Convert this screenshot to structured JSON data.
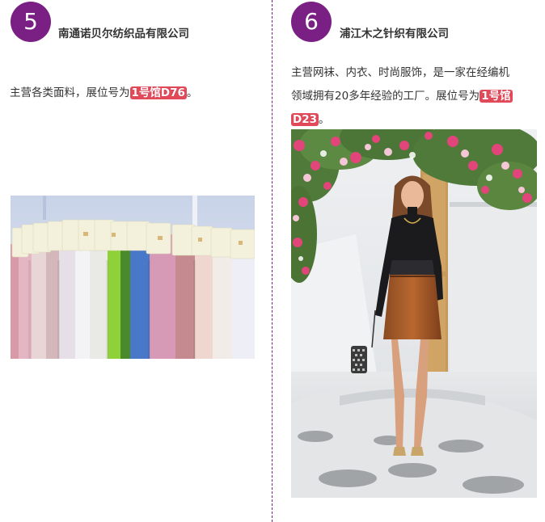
{
  "colors": {
    "accent_purple": "#7a1f83",
    "booth_highlight": "#e24a5a"
  },
  "left": {
    "number": "5",
    "company": "南通诺贝尔纺织品有限公司",
    "desc_prefix": "主营各类面料，展位号为",
    "booth": "1号馆D76",
    "desc_suffix": "。",
    "image_icon": "fabric-swatches-photo"
  },
  "right": {
    "number": "6",
    "company": "浦江木之针织有限公司",
    "desc_line1": "主营网袜、内衣、时尚服饰，是一家在经编机",
    "desc_line2_prefix": "领域拥有20多年经验的工厂。展位号为",
    "booth_part1": "1号馆",
    "booth_part2": "D23",
    "desc_suffix": "。",
    "image_icon": "fashion-model-photo"
  }
}
